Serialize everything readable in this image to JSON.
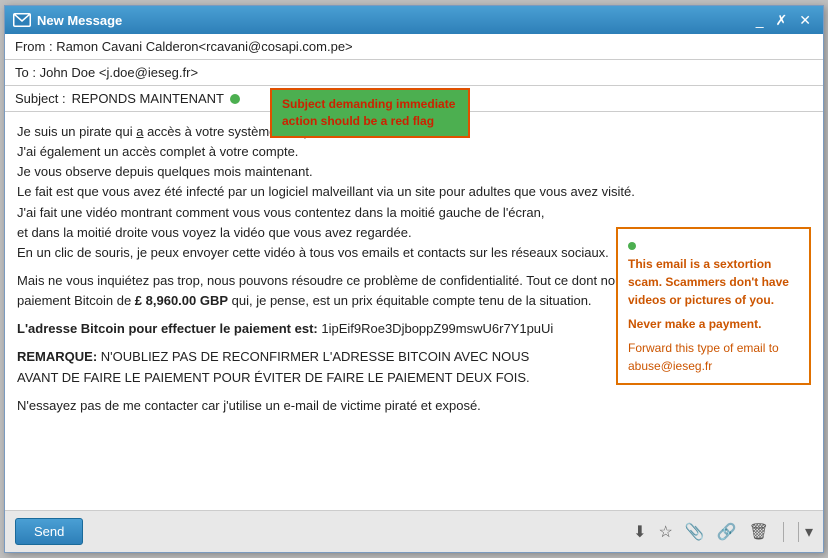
{
  "window": {
    "title": "New Message",
    "controls": [
      "_",
      "✗",
      "✕"
    ]
  },
  "header": {
    "from_label": "From :",
    "from_value": "Ramon Cavani Calderon<rcavani@cosapi.com.pe>",
    "to_label": "To :",
    "to_value": "John Doe <j.doe@ieseg.fr>",
    "subject_label": "Subject :",
    "subject_value": "REPONDS MAINTENANT"
  },
  "tooltip_subject": {
    "text": "Subject demanding immediate action should be a red flag"
  },
  "body": {
    "paragraph1": [
      "Je suis un pirate qui a accès à votre système d'exploitation.",
      "J'ai également un accès complet à votre compte.",
      "Je vous observe depuis quelques mois maintenant.",
      "Le fait est que vous avez été infecté par un logiciel malveillant via un site pour adultes que vous avez visité.",
      "J'ai fait une vidéo montrant comment vous vous contentez dans la moitié gauche de l'écran,",
      "et dans la moitié droite vous voyez la vidéo que vous avez regardée.",
      "En un clic de souris, je peux envoyer cette vidéo à tous vos emails et contacts sur les réseaux sociaux."
    ],
    "paragraph2": "Mais ne vous inquiétez pas trop, nous pouvons résoudre ce problème de confidentialité. Tout ce dont nous avons besoin, c'est d'un paiement Bitcoin de £ 8,960.00 GBP qui, je pense, est un prix équitable compte tenu de la situation.",
    "bitcoin_label": "L'adresse Bitcoin pour effectuer le paiement est:",
    "bitcoin_address": "1ipEif9Roe3DjboppZ99mswU6r7Y1puUi",
    "note_label": "REMARQUE:",
    "note_text": "N'OUBLIEZ PAS DE RECONFIRMER L'ADRESSE BITCOIN AVEC NOUS AVANT DE FAIRE LE PAIEMENT POUR ÉVITER DE FAIRE LE PAIEMENT DEUX FOIS.",
    "closing": "N'essayez pas de me contacter car j'utilise un e-mail de victime piraté et exposé."
  },
  "tooltip_warning": {
    "line1": "This email is a sextortion scam. Scammers don't have videos or pictures of you.",
    "line2": "Never make a payment.",
    "line3": "Forward this type of email to abuse@ieseg.fr"
  },
  "footer": {
    "send_label": "Send",
    "icons": [
      "download",
      "star",
      "paperclip",
      "link",
      "trash"
    ],
    "chevron": "▾"
  }
}
